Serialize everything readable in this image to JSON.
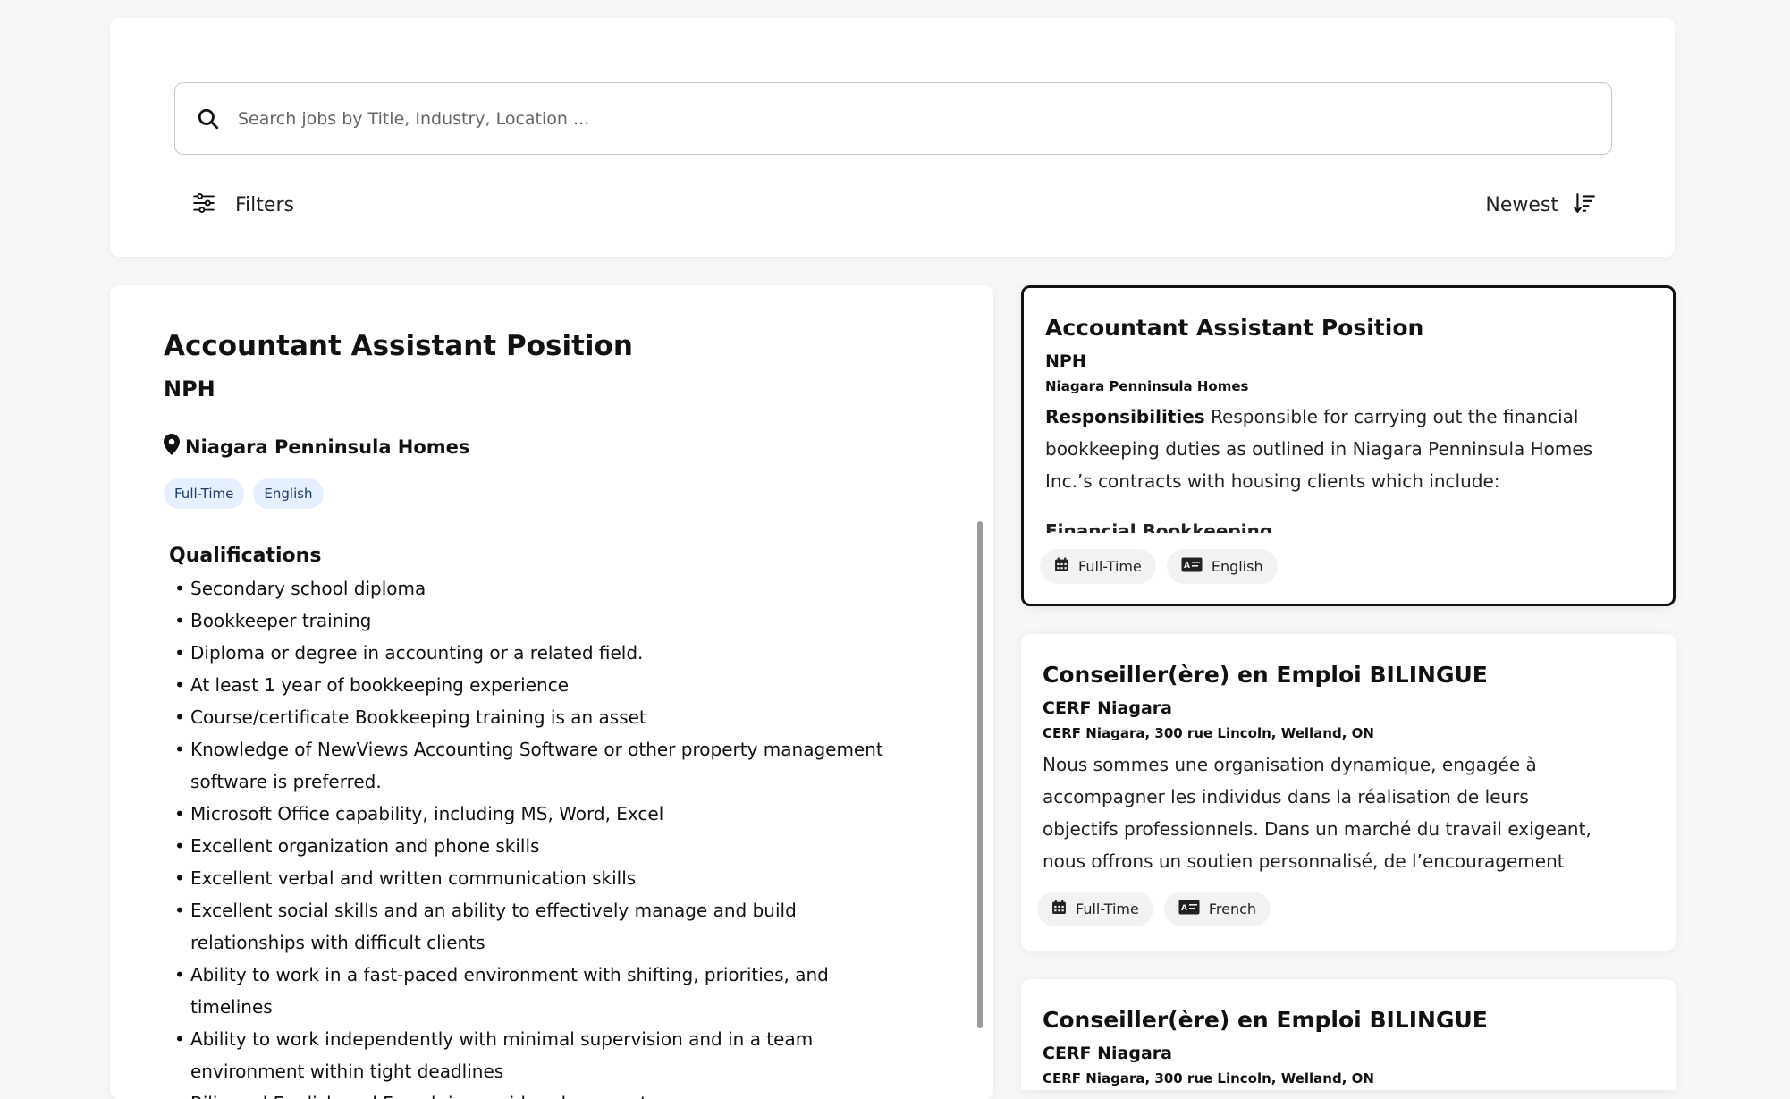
{
  "search": {
    "placeholder": "Search jobs by Title, Industry, Location ..."
  },
  "toolbar": {
    "filters_label": "Filters",
    "sort_label": "Newest"
  },
  "detail": {
    "title": "Accountant Assistant Position",
    "company": "NPH",
    "location": "Niagara Penninsula Homes",
    "tags": [
      "Full-Time",
      "English"
    ],
    "section_heading": "Qualifications",
    "qualifications": [
      "Secondary school diploma",
      "Bookkeeper training",
      "Diploma or degree in accounting or a related field.",
      "At least 1 year of bookkeeping experience",
      "Course/certificate Bookkeeping training is an asset",
      "Knowledge of NewViews Accounting Software or other property management software is preferred.",
      "Microsoft Office capability, including MS, Word, Excel",
      "Excellent organization and phone skills",
      "Excellent verbal and written communication skills",
      "Excellent social skills and an ability to effectively manage and build relationships with difficult clients",
      "Ability to work in a fast-paced environment with shifting, priorities, and timelines",
      "Ability to work independently with minimal supervision and in a team environment within tight deadlines",
      "Bilingual English and French is considered an asset"
    ]
  },
  "job_list": [
    {
      "title": "Accountant Assistant Position",
      "company": "NPH",
      "location": "Niagara Penninsula Homes",
      "desc_heading": "Responsibilities",
      "description": "Responsible for carrying out the financial bookkeeping duties as outlined in Niagara Penninsula Homes Inc.’s contracts with housing clients which include:",
      "desc_overflow": "Financial Bookkeeping",
      "type": "Full-Time",
      "language": "English"
    },
    {
      "title": "Conseiller(ère) en Emploi BILINGUE",
      "company": "CERF Niagara",
      "location": "CERF Niagara, 300 rue Lincoln, Welland, ON",
      "description": "Nous sommes une organisation dynamique, engagée à accompagner les individus dans la réalisation de leurs objectifs professionnels. Dans un marché du travail exigeant, nous offrons un soutien personnalisé, de l’encouragement et...",
      "type": "Full-Time",
      "language": "French"
    },
    {
      "title": "Conseiller(ère) en Emploi BILINGUE",
      "company": "CERF Niagara",
      "location": "CERF Niagara, 300 rue Lincoln, Welland, ON"
    }
  ]
}
